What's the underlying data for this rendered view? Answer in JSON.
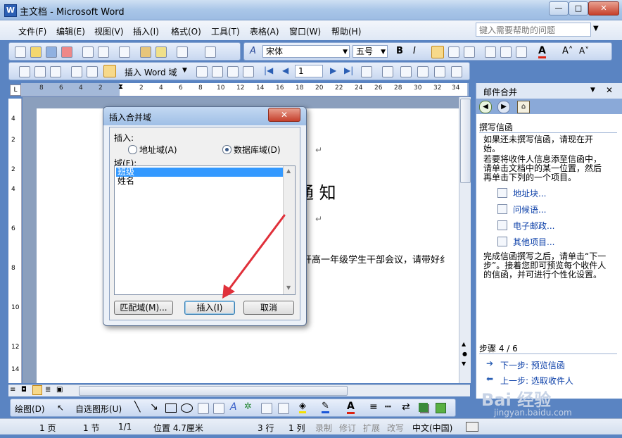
{
  "window": {
    "title": "主文档 - Microsoft Word",
    "min": "—",
    "max": "□",
    "close": "✕"
  },
  "menu": [
    "文件(F)",
    "编辑(E)",
    "视图(V)",
    "插入(I)",
    "格式(O)",
    "工具(T)",
    "表格(A)",
    "窗口(W)",
    "帮助(H)"
  ],
  "help_box": {
    "placeholder": "键入需要帮助的问题"
  },
  "format_bar": {
    "font": "宋体",
    "size": "五号",
    "bold": "B",
    "italic": "I",
    "font_color": "A"
  },
  "mailmerge_bar": {
    "insert_word_field": "插入 Word 域",
    "record": "1"
  },
  "ruler": {
    "labels": [
      "8",
      "6",
      "4",
      "2",
      "2",
      "4",
      "6",
      "8",
      "10",
      "12",
      "14",
      "16",
      "18",
      "20",
      "22",
      "24",
      "26",
      "28",
      "30",
      "32",
      "34"
    ]
  },
  "vruler": {
    "labels": [
      "4",
      "2",
      "2",
      "4",
      "6",
      "8",
      "10",
      "12",
      "14"
    ]
  },
  "document": {
    "heading": "通 知",
    "body_line": "开高一年级学生干部会议，请带好纟",
    "para_mark": "↵"
  },
  "dialog": {
    "title": "插入合并域",
    "insert_label": "插入:",
    "address_field": "地址域(A)",
    "database_field": "数据库域(D)",
    "fields_label": "域(F):",
    "fields": [
      "班级",
      "姓名"
    ],
    "match_fields": "匹配域(M)...",
    "insert": "插入(I)",
    "cancel": "取消"
  },
  "taskpane": {
    "title": "邮件合并",
    "section": "撰写信函",
    "para1": "如果还未撰写信函，请现在开始。",
    "para2": "若要将收件人信息添至信函中，请单击文档中的某一位置，然后再单击下列的一个项目。",
    "links": [
      "地址块...",
      "问候语...",
      "电子邮政...",
      "其他项目..."
    ],
    "para3": "完成信函撰写之后，请单击“下一步”。接着您即可预览每个收件人的信函，并可进行个性化设置。",
    "step": "步骤 4 / 6",
    "next": "下一步: 预览信函",
    "prev": "上一步: 选取收件人"
  },
  "drawbar": {
    "draw": "绘图(D)",
    "autoshapes": "自选图形(U)"
  },
  "status": {
    "page": "1 页",
    "section": "1 节",
    "pages": "1/1",
    "position": "位置 4.7厘米",
    "line": "3 行",
    "col": "1 列",
    "rec": "录制",
    "rev": "修订",
    "ext": "扩展",
    "ovr": "改写",
    "lang": "中文(中国)"
  },
  "watermark": {
    "brand": "Bai 经验",
    "url": "jingyan.baidu.com"
  },
  "colors": {
    "accent": "#3399ff",
    "arrow": "#e0303a",
    "link": "#0b3fa8"
  }
}
